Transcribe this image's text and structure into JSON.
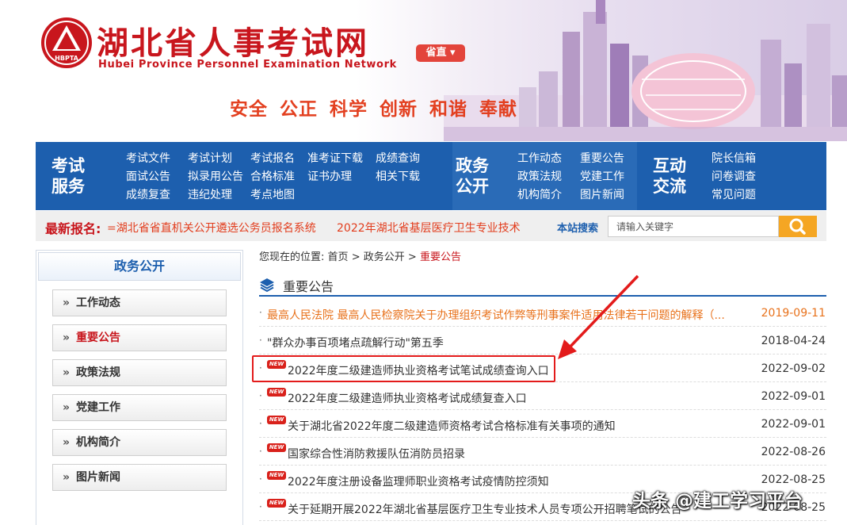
{
  "header": {
    "title": "湖北省人事考试网",
    "subtitle_en": "Hubei Province Personnel Examination Network",
    "logo_text": "HBPTA",
    "region_label": "省直",
    "slogan": "安全 公正 科学 创新 和谐 奉献"
  },
  "nav": {
    "groups": [
      {
        "title_line1": "考试",
        "title_line2": "服务",
        "links": [
          "考试文件",
          "考试计划",
          "考试报名",
          "准考证下载",
          "成绩查询",
          "面试公告",
          "拟录用公告",
          "合格标准",
          "证书办理",
          "相关下载",
          "成绩复查",
          "违纪处理",
          "考点地图"
        ]
      },
      {
        "title_line1": "政务",
        "title_line2": "公开",
        "links": [
          "工作动态",
          "重要公告",
          "政策法规",
          "党建工作",
          "机构简介",
          "图片新闻"
        ]
      },
      {
        "title_line1": "互动",
        "title_line2": "交流",
        "links": [
          "院长信箱",
          "问卷调查",
          "常见问题"
        ]
      }
    ]
  },
  "info_bar": {
    "latest_label": "最新报名:",
    "latest_items": [
      "=湖北省省直机关公开遴选公务员报名系统",
      "2022年湖北省基层医疗卫生专业技术"
    ],
    "search_label": "本站搜索",
    "search_placeholder": "请输入关键字"
  },
  "sidebar": {
    "title": "政务公开",
    "items": [
      "工作动态",
      "重要公告",
      "政策法规",
      "党建工作",
      "机构简介",
      "图片新闻"
    ],
    "active_index": 1,
    "chevron": "»"
  },
  "breadcrumb": {
    "prefix": "您现在的位置:",
    "home": "首页",
    "sep": ">",
    "section": "政务公开",
    "current": "重要公告"
  },
  "section": {
    "title": "重要公告"
  },
  "news": [
    {
      "title": "最高人民法院 最高人民检察院关于办理组织考试作弊等刑事案件适用法律若干问题的解释（...",
      "date": "2019-09-11",
      "is_new": false,
      "featured": true
    },
    {
      "title": "\"群众办事百项堵点疏解行动\"第五季",
      "date": "2018-04-24",
      "is_new": false,
      "featured": false
    },
    {
      "title": "2022年度二级建造师执业资格考试笔试成绩查询入口",
      "date": "2022-09-02",
      "is_new": true,
      "featured": false
    },
    {
      "title": "2022年度二级建造师执业资格考试成绩复查入口",
      "date": "2022-09-01",
      "is_new": true,
      "featured": false
    },
    {
      "title": "关于湖北省2022年度二级建造师资格考试合格标准有关事项的通知",
      "date": "2022-09-01",
      "is_new": true,
      "featured": false
    },
    {
      "title": "国家综合性消防救援队伍消防员招录",
      "date": "2022-08-26",
      "is_new": true,
      "featured": false
    },
    {
      "title": "2022年度注册设备监理师职业资格考试疫情防控须知",
      "date": "2022-08-25",
      "is_new": true,
      "featured": false
    },
    {
      "title": "关于延期开展2022年湖北省基层医疗卫生专业技术人员专项公开招聘笔试的公告",
      "date": "2022-08-25",
      "is_new": true,
      "featured": false
    }
  ],
  "new_badge_text": "NEW",
  "bullet": "·",
  "watermark": "头条 @建工学习平台",
  "colors": {
    "brand_red": "#c8161d",
    "nav_blue": "#1d5fae",
    "highlight": "#e31b1b",
    "search_orange": "#f5a623"
  }
}
